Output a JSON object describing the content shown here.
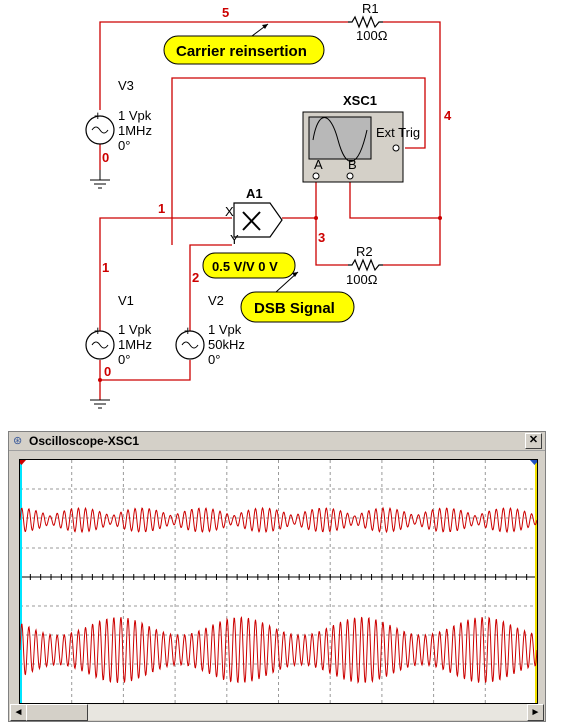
{
  "schematic": {
    "sources": [
      {
        "name": "V3",
        "amplitude": "1 Vpk",
        "frequency": "1MHz",
        "phase": "0°"
      },
      {
        "name": "V1",
        "amplitude": "1 Vpk",
        "frequency": "1MHz",
        "phase": "0°"
      },
      {
        "name": "V2",
        "amplitude": "1 Vpk",
        "frequency": "50kHz",
        "phase": "0°"
      }
    ],
    "resistors": [
      {
        "name": "R1",
        "value": "100Ω"
      },
      {
        "name": "R2",
        "value": "100Ω"
      }
    ],
    "multiplier": {
      "name": "A1",
      "params": "0.5 V/V 0 V",
      "x_label": "X",
      "y_label": "Y"
    },
    "scope": {
      "name": "XSC1",
      "ext_trig": "Ext Trig",
      "ch_a": "A",
      "ch_b": "B"
    },
    "nets": [
      "5",
      "4",
      "1",
      "2",
      "3",
      "0",
      "0",
      "1"
    ],
    "notes": {
      "carrier": "Carrier reinsertion",
      "dsb": "DSB Signal"
    }
  },
  "oscilloscope_window": {
    "title": "Oscilloscope-XSC1",
    "close_label": "✕",
    "trace_color": "#cc0000",
    "scroll_left": "◄",
    "scroll_right": "►"
  }
}
